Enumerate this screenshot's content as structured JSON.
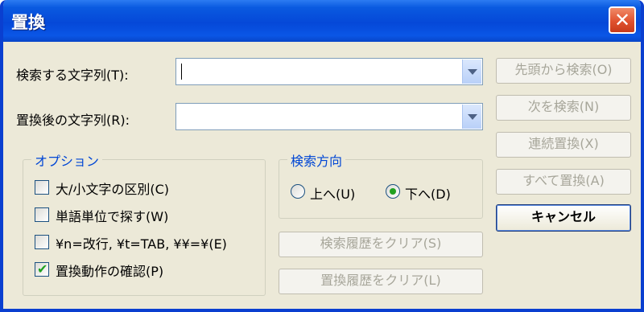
{
  "window": {
    "title": "置換",
    "close_symbol": "✕"
  },
  "search": {
    "label": "検索する文字列(T):",
    "value": ""
  },
  "replace": {
    "label": "置換後の文字列(R):",
    "value": ""
  },
  "options": {
    "legend": "オプション",
    "items": [
      {
        "label": "大/小文字の区別(C)",
        "checked": false
      },
      {
        "label": "単語単位で探す(W)",
        "checked": false
      },
      {
        "label": "¥n=改行, ¥t=TAB, ¥¥=¥(E)",
        "checked": false
      },
      {
        "label": "置換動作の確認(P)",
        "checked": true
      }
    ]
  },
  "direction": {
    "legend": "検索方向",
    "up_label": "上へ(U)",
    "down_label": "下へ(D)",
    "selected": "down"
  },
  "history": {
    "clear_search": "検索履歴をクリア(S)",
    "clear_replace": "置換履歴をクリア(L)"
  },
  "buttons": {
    "find_from_start": "先頭から検索(O)",
    "find_next": "次を検索(N)",
    "replace_next": "連続置換(X)",
    "replace_all": "すべて置換(A)",
    "cancel": "キャンセル"
  }
}
